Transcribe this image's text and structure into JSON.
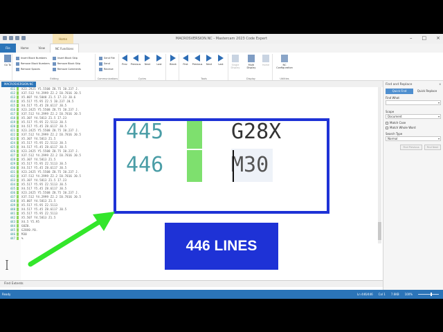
{
  "window": {
    "title": "MACROSVERSION.NC - Mastercam 2023 Code Expert",
    "context_tab": "Home"
  },
  "tabs": [
    "File",
    "Home",
    "View",
    "NC Functions"
  ],
  "active_tab": "NC Functions",
  "ribbon": {
    "groups": {
      "editing": {
        "label": "Editing",
        "items": [
          "Insert Block Numbers",
          "Remove Block Numbers",
          "Remove Spaces",
          "Insert Block Skip",
          "Remove Block Skip",
          "Remove Comments"
        ]
      },
      "communications": {
        "label": "Communications",
        "items": [
          "Send File",
          "Send",
          "Receive"
        ]
      },
      "nc_cycles": {
        "label": "Cycles",
        "items": [
          "Prev",
          "Previous",
          "Next",
          "Last"
        ]
      },
      "tools": {
        "label": "Tools",
        "items": [
          "Blank"
        ]
      },
      "nc_tools": {
        "label": "Tools",
        "items": [
          "First",
          "Previous",
          "Next",
          "Last"
        ]
      },
      "display": {
        "label": "Display",
        "items": [
          "Single Display",
          "Multi Display",
          "Home"
        ]
      },
      "utilities": {
        "label": "Utilities",
        "items": [
          "NC Configuration"
        ]
      }
    },
    "left_big": "Go To",
    "left_big2": "NC"
  },
  "document_tab": "MACROSVERSION.NC",
  "editor": {
    "lines": [
      {
        "n": "411",
        "code": "X23.2925 Y5.5508 Z8.75 I0.237 J."
      },
      {
        "n": "412",
        "code": "X37.512 Y4.2999 Z2.2 I0.7816 J0.5"
      },
      {
        "n": "413",
        "code": "X5.807 Y4.5848 Z1.5 I7.23 J0.6"
      },
      {
        "n": "414",
        "code": "X5.517 Y5.95 Z2.5 I0.237 J0.5"
      },
      {
        "n": "415",
        "code": "X4.517 Y5.45 Z8.6117 J0.5"
      },
      {
        "n": "416",
        "code": "X23.2425 Y5.5508 Z8.75 I0.237 J."
      },
      {
        "n": "417",
        "code": "X37.512 Y4.2999 Z2.2 I0.7816 J0.5"
      },
      {
        "n": "418",
        "code": "X5.307 Y4.5813 Z1.5 I7.23"
      },
      {
        "n": "419",
        "code": "X5.517 Y5.95 Z2.5113 J0.5"
      },
      {
        "n": "420",
        "code": "X4.517 Y5.45 Z8.6117 J0.5"
      },
      {
        "n": "421",
        "code": "X23.2425 Y5.5508 Z8.75 I0.237 J."
      },
      {
        "n": "422",
        "code": "X37.512 Y4.2999 Z2.2 I0.7816 J0.5"
      },
      {
        "n": "423",
        "code": "X5.307 Y4.5813 Z1.5"
      },
      {
        "n": "424",
        "code": "X5.517 Y5.95 Z2.5113 J0.5"
      },
      {
        "n": "425",
        "code": "X4.517 Y5.45 Z8.6117 J0.5"
      },
      {
        "n": "426",
        "code": "X23.2425 Y5.5508 Z8.75 I0.237 J."
      },
      {
        "n": "427",
        "code": "X37.512 Y4.2999 Z2.2 I0.7816 J0.5"
      },
      {
        "n": "428",
        "code": "X5.307 Y4.5813 Z1.5"
      },
      {
        "n": "429",
        "code": "X5.517 Y5.95 Z2.5113 J0.5"
      },
      {
        "n": "430",
        "code": "X4.517 Y5.45 Z8.6117 J0.5"
      },
      {
        "n": "431",
        "code": "X23.2425 Y5.5508 Z8.75 I0.237 J."
      },
      {
        "n": "432",
        "code": "X37.512 Y4.2999 Z2.2 I0.7816 J0.5"
      },
      {
        "n": "433",
        "code": "X5.307 Y4.5813 Z1.5 I7.23"
      },
      {
        "n": "434",
        "code": "X5.517 Y5.95 Z2.5113 J0.5"
      },
      {
        "n": "435",
        "code": "X4.517 Y5.45 Z8.6117 J0.5"
      },
      {
        "n": "436",
        "code": "X23.2425 Y5.5508 Z8.75 I0.237 J."
      },
      {
        "n": "437",
        "code": "X37.512 Y4.2999 Z2.2 I0.7816 J0.5"
      },
      {
        "n": "438",
        "code": "X5.807 Y4.5813 Z1.5"
      },
      {
        "n": "439",
        "code": "X5.517 Y5.95 Z2.5113"
      },
      {
        "n": "440",
        "code": "X4.517 Y5.45 Z8.6117 J0.5"
      },
      {
        "n": "441",
        "code": "X5.517 Y5.95 Z2.5113"
      },
      {
        "n": "442",
        "code": "X5.507 Y4.5813 Z1.5"
      },
      {
        "n": "443",
        "code": "X4.5 Y5.95"
      },
      {
        "n": "444",
        "code": "G0Z0."
      },
      {
        "n": "445",
        "code": "G28X0.Y0."
      },
      {
        "n": "446",
        "code": "M30"
      },
      {
        "n": "447",
        "code": "%"
      }
    ]
  },
  "zoom": {
    "rows": [
      {
        "n": "445",
        "code": "G28X"
      },
      {
        "n": "446",
        "code": "M30"
      }
    ]
  },
  "callout": "446 LINES",
  "find_extents": "Find Extents",
  "status": {
    "left": "Ready",
    "position": "Ln 446/446",
    "col": "Col 1",
    "size": "7.6KB",
    "zoom": "100%"
  },
  "panel": {
    "title": "Find and Replace",
    "close": "x",
    "tabs": [
      "Quick Find",
      "Quick Replace"
    ],
    "find_what_label": "Find What",
    "scope_label": "Scope",
    "scope_value": "Document",
    "match_case": "Match Case",
    "match_whole_word": "Match Whole Word",
    "search_type_label": "Search Type",
    "search_type_value": "Normal",
    "find_previous": "Find Previous",
    "find_next": "Find Next"
  },
  "colors": {
    "accent": "#2b74b8",
    "overlay_blue": "#1e32d6",
    "arrow_green": "#33e62b",
    "marker_green": "#7ee06e",
    "line_number": "#1e8a8a"
  }
}
